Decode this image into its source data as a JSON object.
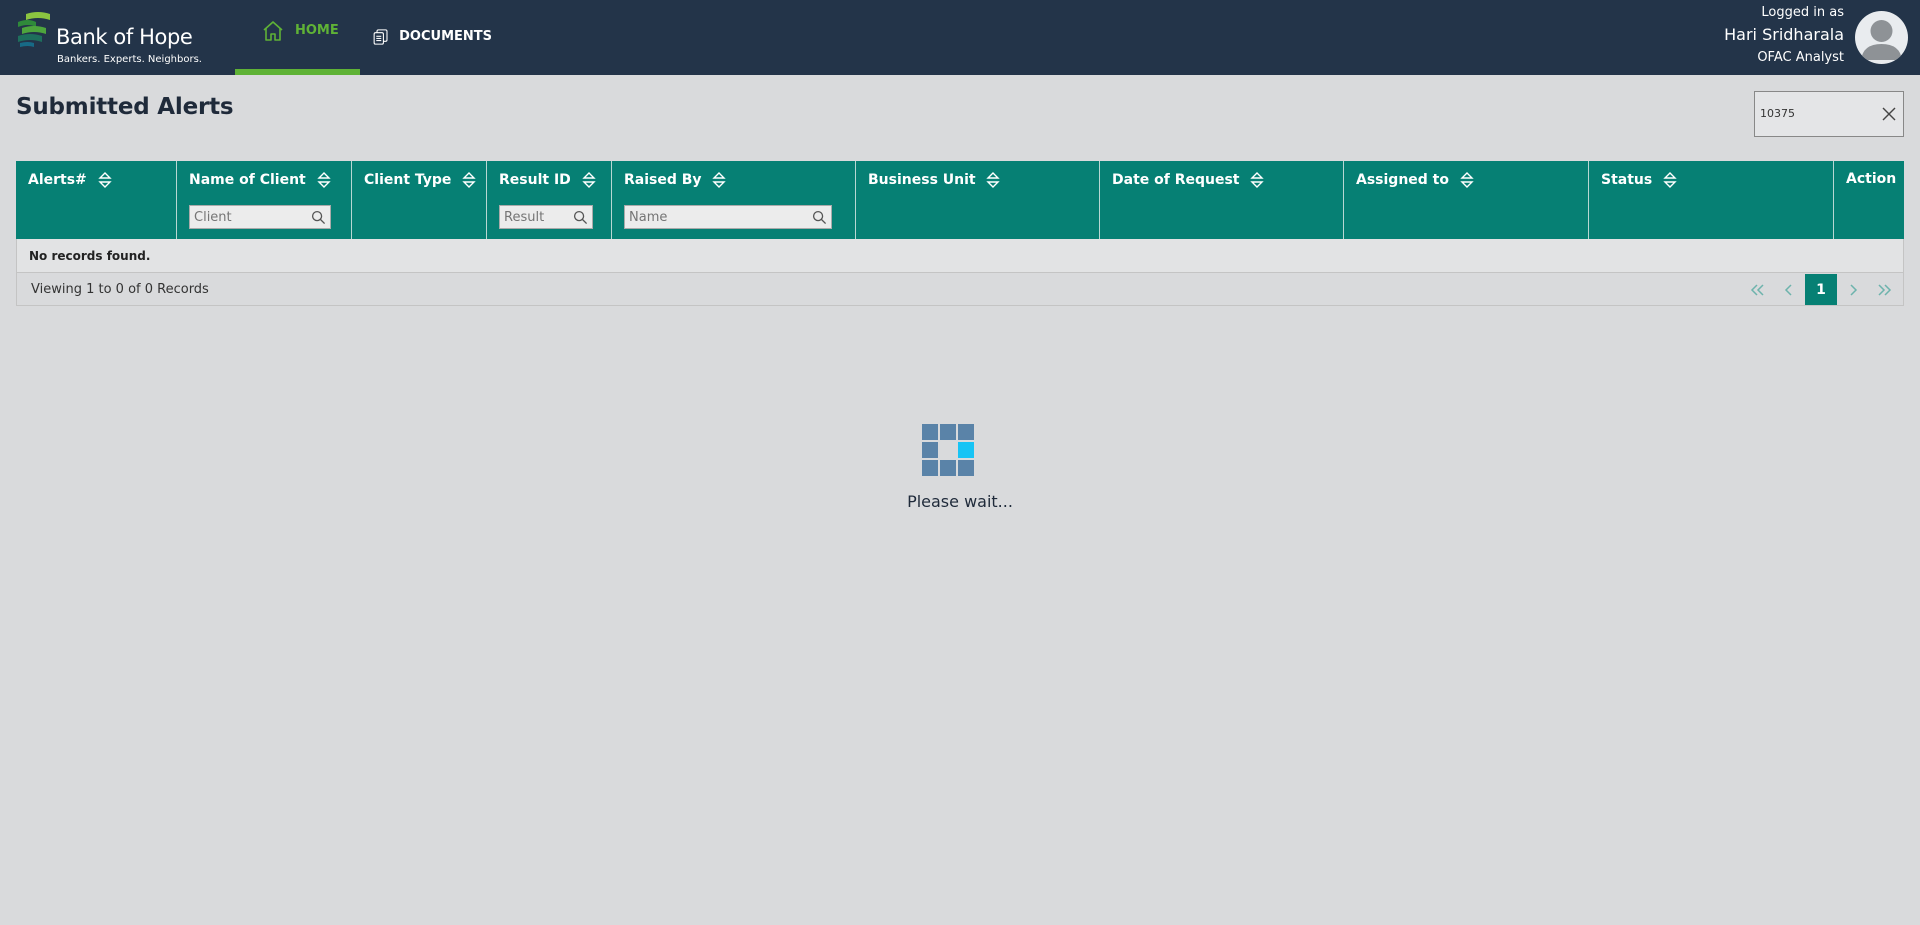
{
  "brand": {
    "name": "Bank of Hope",
    "tagline": "Bankers. Experts. Neighbors."
  },
  "nav": [
    {
      "label": "HOME",
      "icon": "home-icon",
      "active": true
    },
    {
      "label": "DOCUMENTS",
      "icon": "documents-icon",
      "active": false
    }
  ],
  "user": {
    "logged_label": "Logged in as",
    "name": "Hari Sridharala",
    "role": "OFAC Analyst"
  },
  "page": {
    "title": "Submitted Alerts"
  },
  "search": {
    "value": "10375"
  },
  "table": {
    "columns": [
      {
        "label": "Alerts#",
        "sortable": true
      },
      {
        "label": "Name of Client",
        "sortable": true,
        "filter_placeholder": "Client"
      },
      {
        "label": "Client Type",
        "sortable": true
      },
      {
        "label": "Result ID",
        "sortable": true,
        "filter_placeholder": "Result"
      },
      {
        "label": "Raised By",
        "sortable": true,
        "filter_placeholder": "Name"
      },
      {
        "label": "Business Unit",
        "sortable": true
      },
      {
        "label": "Date of Request",
        "sortable": true
      },
      {
        "label": "Assigned to",
        "sortable": true
      },
      {
        "label": "Status",
        "sortable": true
      },
      {
        "label": "Action",
        "sortable": false
      }
    ],
    "empty_message": "No records found.",
    "viewing_text": "Viewing 1 to 0 of 0 Records",
    "pager": {
      "first": "<<",
      "prev": "<",
      "current": "1",
      "next": ">",
      "last": ">>"
    }
  },
  "loader": {
    "text": "Please wait..."
  },
  "colors": {
    "header_bg": "#233449",
    "accent_green": "#5fb236",
    "table_teal": "#068074",
    "page_bg": "#d9dadc",
    "loader_cell": "#5a83a8",
    "loader_active": "#18c4f5"
  }
}
